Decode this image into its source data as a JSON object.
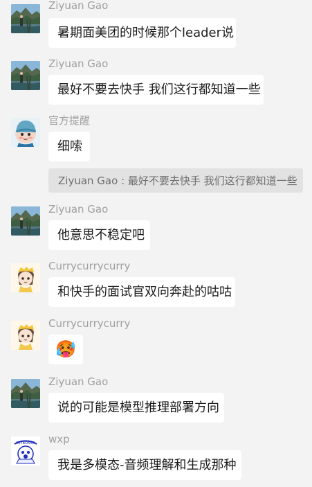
{
  "messages": [
    {
      "sender": "Ziyuan Gao",
      "avatar": "mountain-landscape-avatar",
      "text": "暑期面美团的时候那个leader说"
    },
    {
      "sender": "Ziyuan Gao",
      "avatar": "mountain-landscape-avatar",
      "text": "最好不要去快手 我们这行都知道一些"
    },
    {
      "sender": "官方提醒",
      "avatar": "knit-hat-avatar",
      "text": "细嗦"
    },
    {
      "sender": "Ziyuan Gao",
      "avatar": "mountain-landscape-avatar",
      "text": "他意思不稳定吧"
    },
    {
      "sender": "Currycurrycurry",
      "avatar": "anime-girl-avatar",
      "text": "和快手的面试官双向奔赴的咕咕"
    },
    {
      "sender": "Currycurrycurry",
      "avatar": "anime-girl-avatar",
      "text": "🥵"
    },
    {
      "sender": "Ziyuan Gao",
      "avatar": "mountain-landscape-avatar",
      "text": "说的可能是模型推理部署方向"
    },
    {
      "sender": "wxp",
      "avatar": "cartoon-sticker-avatar",
      "text": "我是多模态-音频理解和生成那种"
    }
  ],
  "quote": {
    "sender": "Ziyuan Gao",
    "separator": " : ",
    "text": "最好不要去快手 我们这行都知道一些"
  },
  "colors": {
    "background": "#f3f3f3",
    "bubble": "#ffffff",
    "quote_background": "#e2e2e2",
    "sender_text": "#9f9f9f"
  }
}
